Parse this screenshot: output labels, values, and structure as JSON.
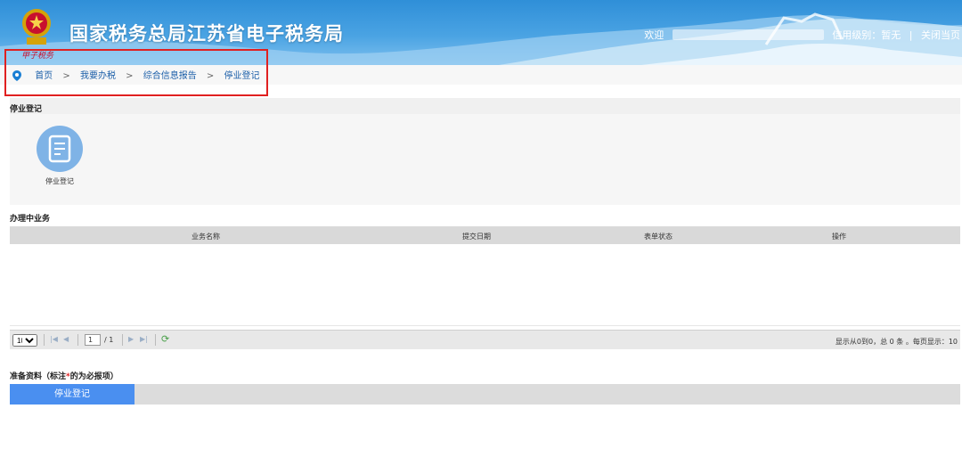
{
  "header": {
    "site_title": "国家税务总局江苏省电子税务局",
    "welcome": "欢迎",
    "credit_level_label": "信用级别：暂无",
    "divider": "|",
    "close_page": "关闭当页",
    "watermark": "甲子税务"
  },
  "breadcrumb": {
    "items": [
      "首页",
      "我要办税",
      "综合信息报告",
      "停业登记"
    ],
    "separator": ">"
  },
  "section_register": {
    "title": "停业登记",
    "icon_label": "停业登记",
    "icon": "document-icon"
  },
  "section_in_progress": {
    "title": "办理中业务",
    "columns": [
      "业务名称",
      "提交日期",
      "表单状态",
      "操作"
    ]
  },
  "pager": {
    "page_size": "10",
    "current_page": "1",
    "total_pages": "/ 1",
    "info": "显示从0到0，总 0 条 。每页显示：10"
  },
  "section_materials": {
    "title_prefix": "准备资料（标注",
    "title_star": "*",
    "title_suffix": "的为必报项）",
    "tab_label": "停业登记"
  },
  "colors": {
    "header_blue": "#2f8fd8",
    "tab_active": "#4a8ff0",
    "highlight_red": "#e02020"
  }
}
